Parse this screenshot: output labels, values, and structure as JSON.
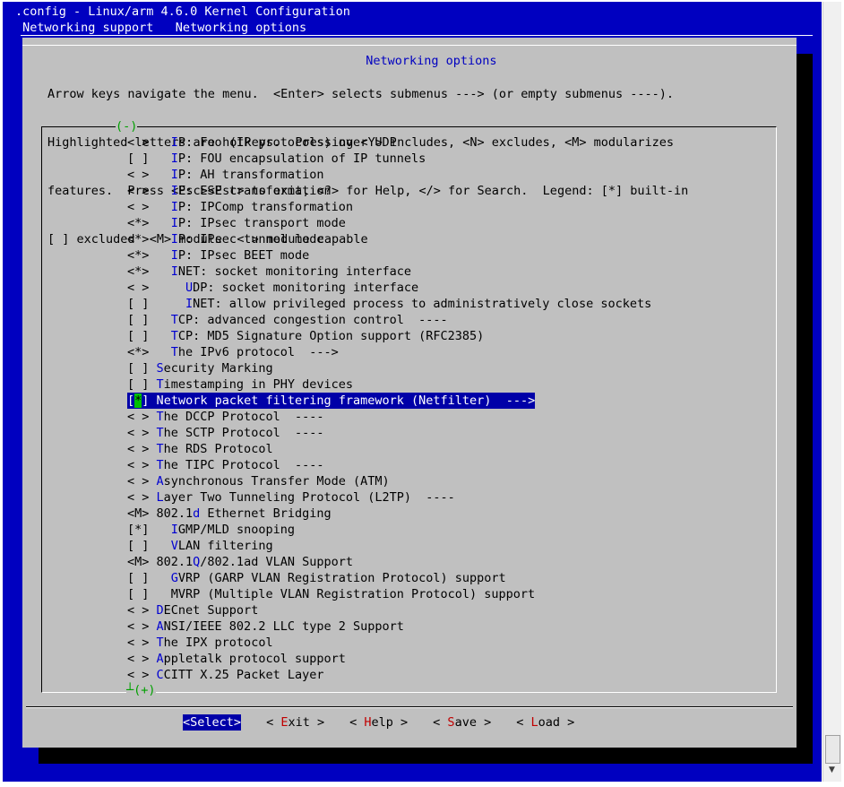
{
  "terminal": {
    "title": ".config - Linux/arm 4.6.0 Kernel Configuration",
    "breadcrumb": " Networking support   Networking options "
  },
  "dialog": {
    "title": "Networking options",
    "help_lines": [
      "Arrow keys navigate the menu.  <Enter> selects submenus ---> (or empty submenus ----).",
      "Highlighted letters are hotkeys.  Pressing <Y> includes, <N> excludes, <M> modularizes",
      "features.  Press <Esc><Esc> to exit, <?> for Help, </> for Search.  Legend: [*] built-in",
      "[ ] excluded  <M> module  < > module capable"
    ],
    "scroll_up": "(-)",
    "scroll_down": "┴(+)"
  },
  "menu_items": [
    {
      "pre": "< >   ",
      "hk": "I",
      "rest": "P: Foo (IP protocols) over UDP"
    },
    {
      "pre": "[ ]   ",
      "hk": "I",
      "rest": "P: FOU encapsulation of IP tunnels"
    },
    {
      "pre": "< >   ",
      "hk": "I",
      "rest": "P: AH transformation"
    },
    {
      "pre": "< >   ",
      "hk": "I",
      "rest": "P: ESP transformation"
    },
    {
      "pre": "< >   ",
      "hk": "I",
      "rest": "P: IPComp transformation"
    },
    {
      "pre": "<*>   ",
      "hk": "I",
      "rest": "P: IPsec transport mode"
    },
    {
      "pre": "<*>   ",
      "hk": "I",
      "rest": "P: IPsec tunnel mode"
    },
    {
      "pre": "<*>   ",
      "hk": "I",
      "rest": "P: IPsec BEET mode"
    },
    {
      "pre": "<*>   ",
      "hk": "I",
      "rest": "NET: socket monitoring interface"
    },
    {
      "pre": "< >     ",
      "hk": "U",
      "rest": "DP: socket monitoring interface"
    },
    {
      "pre": "[ ]     ",
      "hk": "I",
      "rest": "NET: allow privileged process to administratively close sockets"
    },
    {
      "pre": "[ ]   ",
      "hk": "T",
      "rest": "CP: advanced congestion control  ----"
    },
    {
      "pre": "[ ]   ",
      "hk": "T",
      "rest": "CP: MD5 Signature Option support (RFC2385)"
    },
    {
      "pre": "<*>   ",
      "hk": "T",
      "rest": "he IPv6 protocol  --->"
    },
    {
      "pre": "[ ] ",
      "hk": "S",
      "rest": "ecurity Marking"
    },
    {
      "pre": "[ ] ",
      "hk": "T",
      "rest": "imestamping in PHY devices"
    },
    {
      "pre": "[*] ",
      "hk": "N",
      "rest": "etwork packet filtering framework (Netfilter)  --->",
      "selected": true
    },
    {
      "pre": "< > ",
      "hk": "T",
      "rest": "he DCCP Protocol  ----"
    },
    {
      "pre": "< > ",
      "hk": "T",
      "rest": "he SCTP Protocol  ----"
    },
    {
      "pre": "< > ",
      "hk": "T",
      "rest": "he RDS Protocol"
    },
    {
      "pre": "< > ",
      "hk": "T",
      "rest": "he TIPC Protocol  ----"
    },
    {
      "pre": "< > ",
      "hk": "A",
      "rest": "synchronous Transfer Mode (ATM)"
    },
    {
      "pre": "< > ",
      "hk": "L",
      "rest": "ayer Two Tunneling Protocol (L2TP)  ----"
    },
    {
      "pre": "<M> 802.1",
      "hk": "d",
      "rest": " Ethernet Bridging"
    },
    {
      "pre": "[*]   ",
      "hk": "I",
      "rest": "GMP/MLD snooping"
    },
    {
      "pre": "[ ]   ",
      "hk": "V",
      "rest": "LAN filtering"
    },
    {
      "pre": "<M> 802.1",
      "hk": "Q",
      "rest": "/802.1ad VLAN Support"
    },
    {
      "pre": "[ ]   ",
      "hk": "G",
      "rest": "VRP (GARP VLAN Registration Protocol) support"
    },
    {
      "pre": "[ ]   M",
      "hk": "",
      "rest": "VRP (Multiple VLAN Registration Protocol) support"
    },
    {
      "pre": "< > ",
      "hk": "D",
      "rest": "ECnet Support"
    },
    {
      "pre": "< > ",
      "hk": "A",
      "rest": "NSI/IEEE 802.2 LLC type 2 Support"
    },
    {
      "pre": "< > ",
      "hk": "T",
      "rest": "he IPX protocol"
    },
    {
      "pre": "< > ",
      "hk": "A",
      "rest": "ppletalk protocol support"
    },
    {
      "pre": "< > ",
      "hk": "C",
      "rest": "CITT X.25 Packet Layer"
    }
  ],
  "buttons": [
    {
      "name": "select",
      "pre": "<",
      "hk": "S",
      "rest": "elect>",
      "active": true
    },
    {
      "name": "exit",
      "pre": "< ",
      "hk": "E",
      "rest": "xit >"
    },
    {
      "name": "help",
      "pre": "< ",
      "hk": "H",
      "rest": "elp >"
    },
    {
      "name": "save",
      "pre": "< ",
      "hk": "S",
      "rest": "ave >"
    },
    {
      "name": "load",
      "pre": "< ",
      "hk": "L",
      "rest": "oad >"
    }
  ],
  "colors": {
    "terminal_bg": "#0000c0",
    "dialog_bg": "#c0c0c0",
    "selection_bg": "#0000a8",
    "hotkey": "#0000d0",
    "button_hotkey": "#c00000",
    "scroll_indicator": "#00a000"
  },
  "icons": {
    "scrollbar_down": "down-arrow-icon"
  }
}
